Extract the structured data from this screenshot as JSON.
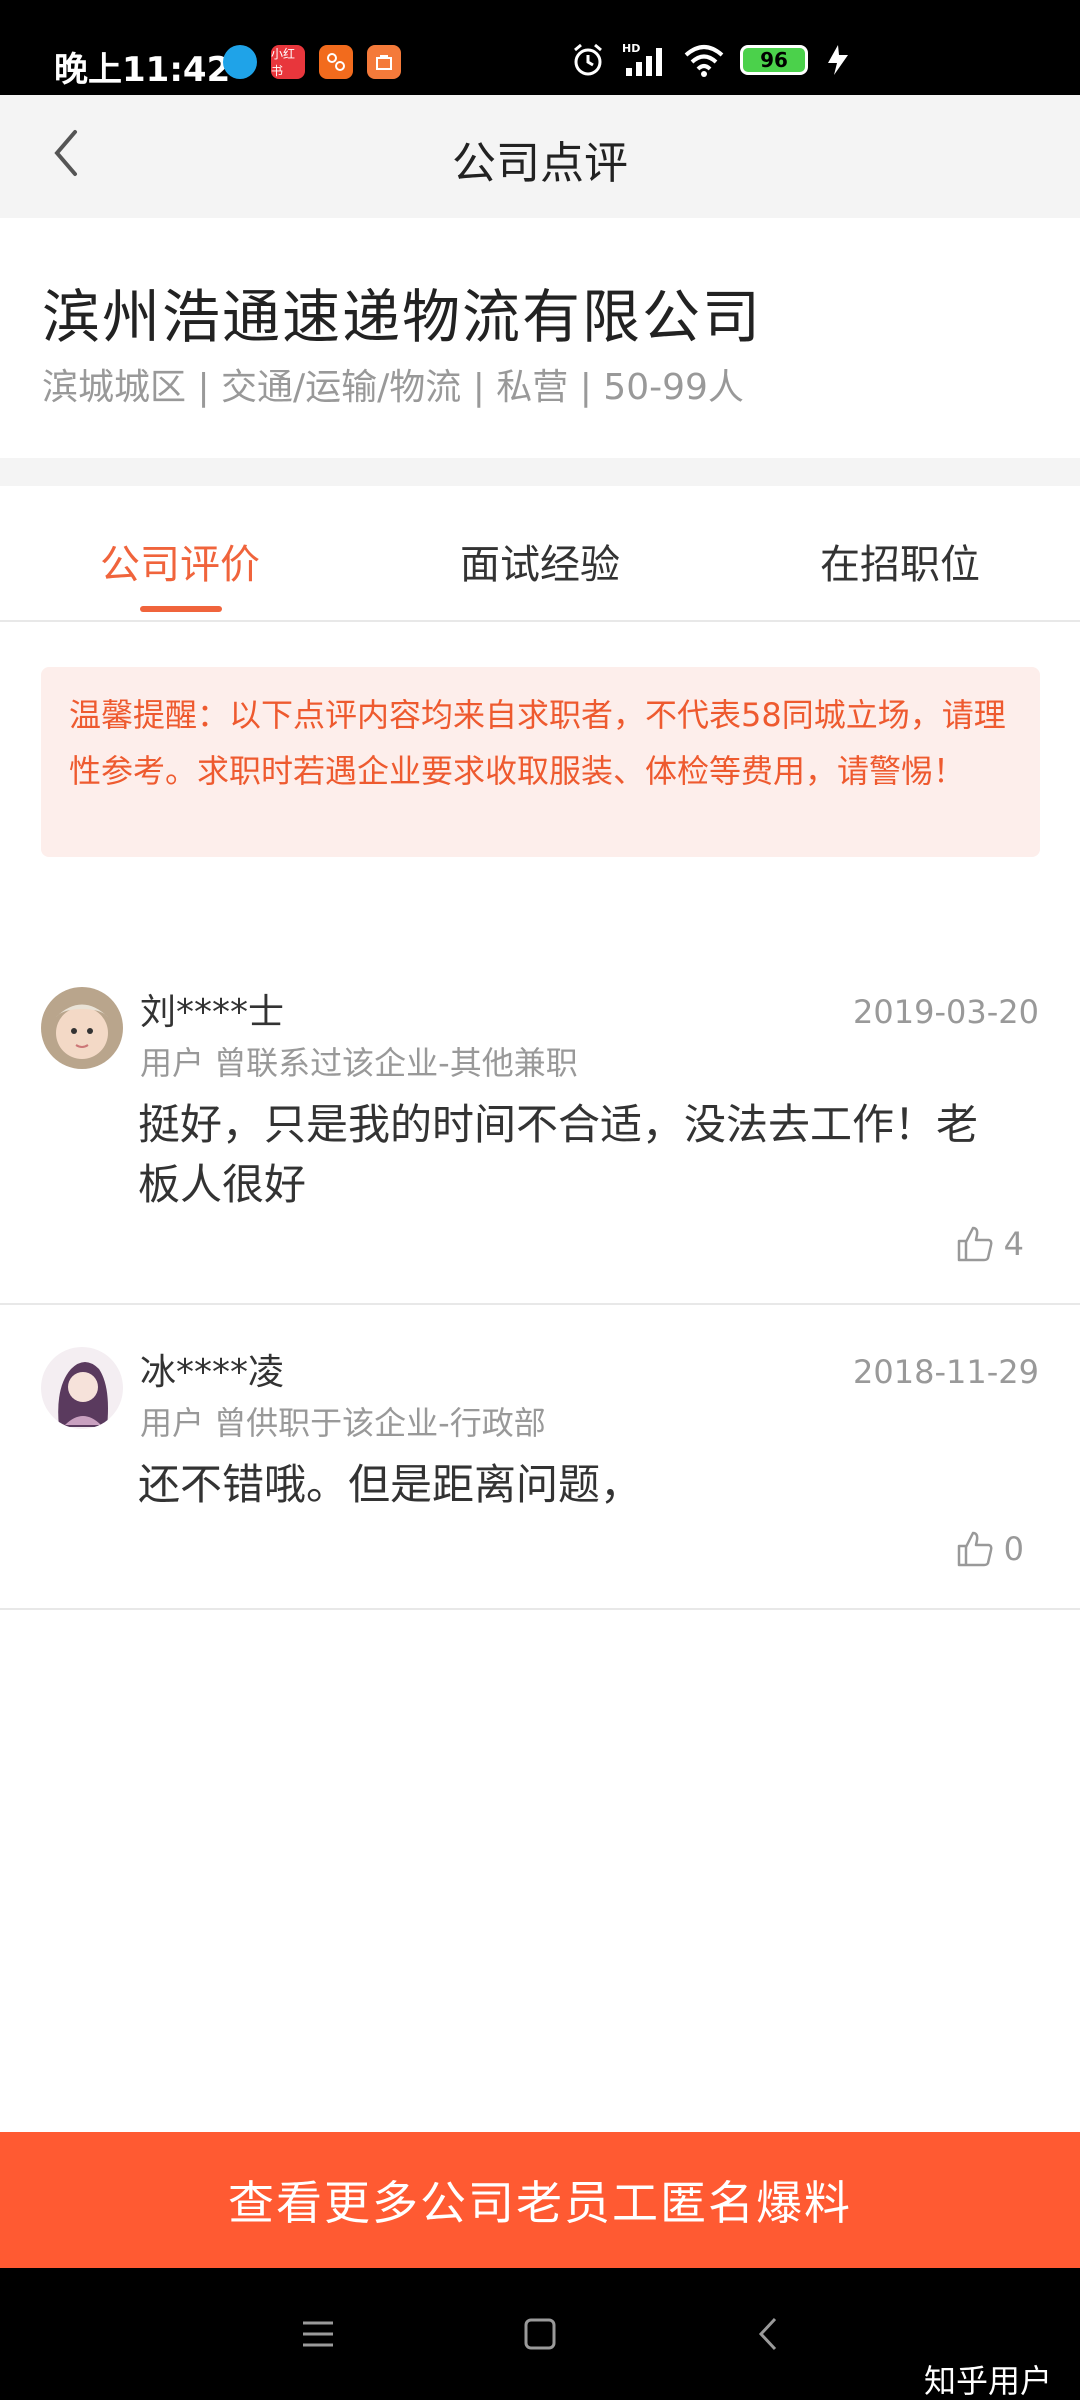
{
  "status_bar": {
    "time": "晚上11:42",
    "app_icons": [
      "bubble-app-icon",
      "xiaohongshu-app-icon",
      "taobao-app-icon",
      "shop-app-icon"
    ],
    "xiaohongshu_label": "小红书",
    "battery": "96"
  },
  "header": {
    "title": "公司点评"
  },
  "company": {
    "name": "滨州浩通速递物流有限公司",
    "meta": "滨城城区 | 交通/运输/物流 | 私营 | 50-99人"
  },
  "tabs": [
    {
      "label": "公司评价",
      "active": true
    },
    {
      "label": "面试经验",
      "active": false
    },
    {
      "label": "在招职位",
      "active": false
    }
  ],
  "notice": {
    "text": "温馨提醒：以下点评内容均来自求职者，不代表58同城立场，请理性参考。求职时若遇企业要求收取服装、体检等费用，请警惕！"
  },
  "reviews": [
    {
      "name": "刘****士",
      "date": "2019-03-20",
      "relation": "用户 曾联系过该企业-其他兼职",
      "text": "挺好，只是我的时间不合适，没法去工作！老板人很好",
      "likes": "4"
    },
    {
      "name": "冰****凌",
      "date": "2018-11-29",
      "relation": "用户 曾供职于该企业-行政部",
      "text": "还不错哦。但是距离问题，",
      "likes": "0"
    }
  ],
  "cta": {
    "label": "查看更多公司老员工匿名爆料"
  },
  "nav": {
    "watermark": "知乎用户"
  },
  "colors": {
    "accent": "#f0643c",
    "cta": "#ff5a32",
    "notice_bg": "#fdeeeb"
  }
}
